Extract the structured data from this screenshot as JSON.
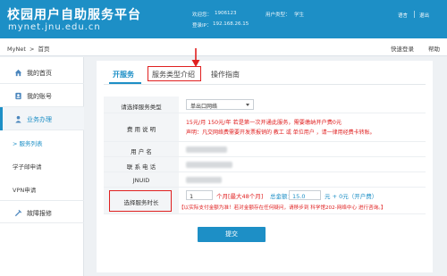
{
  "header": {
    "title": "校园用户自助服务平台",
    "url": "mynet.jnu.edu.cn",
    "login_name_label": "欢迎您：",
    "login_name_value": "1906123",
    "user_type_label": "用户类型：",
    "user_type_value": "学生",
    "ip_label": "登录IP：",
    "ip_value": "192.168.26.15",
    "lang_link": "语言",
    "logout_link": "退出"
  },
  "breadcrumb": {
    "root": "MyNet",
    "sep": ">",
    "current": "首页",
    "quick_login": "快速登录",
    "help": "帮助"
  },
  "sidebar": {
    "items": [
      {
        "label": "我的首页",
        "icon": "home-icon"
      },
      {
        "label": "我的账号",
        "icon": "user-icon"
      },
      {
        "label": "业务办理",
        "icon": "person-icon"
      },
      {
        "label": "故障报修",
        "icon": "tools-icon"
      }
    ],
    "subitems": [
      {
        "label": "> 服务列表"
      },
      {
        "label": "学子邮申请"
      },
      {
        "label": "VPN申请"
      }
    ]
  },
  "tabs": [
    {
      "label": "开服务"
    },
    {
      "label": "服务类型介绍"
    },
    {
      "label": "操作指南"
    }
  ],
  "form": {
    "service_type_label": "请选择服务类型",
    "service_type_value": "单出口网络",
    "fee_label": "费 用 说 明",
    "fee_line1": "15元/月     150元/年   若是第一次开通此服务，需要缴纳开户费0元",
    "fee_line2": "声明：凡交网络费需要开发票报销的 教工 或 单位用户 ，请一律用经费卡转账。",
    "username_label": "用 户 名",
    "phone_label": "联 系 电 话",
    "jnuid_label": "JNUID",
    "duration_label": "选择服务时长",
    "duration_value": "1",
    "duration_unit": "个月[最大48个月]",
    "total_label": "总金额：",
    "total_value": "15.0",
    "total_suffix": "元 + 0元（开户费）",
    "warning": "【以实际支付金额为准！若对金额存在任何疑问，请移步到 科学馆202-网络中心 进行咨询。】",
    "submit_label": "提交"
  },
  "colors": {
    "primary": "#1d8fc6",
    "red": "#e02020",
    "annotation": "#e02020"
  }
}
